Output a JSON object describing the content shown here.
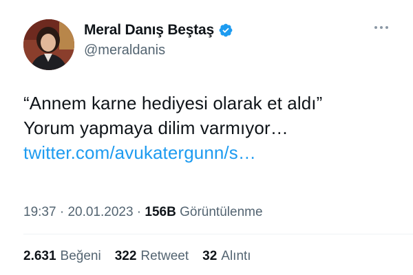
{
  "author": {
    "display_name": "Meral Danış Beştaş",
    "handle": "@meraldanis"
  },
  "tweet": {
    "line1": "“Annem karne hediyesi olarak et aldı”",
    "line2": "Yorum yapmaya dilim varmıyor…",
    "link": "twitter.com/avukatergunn/s…"
  },
  "meta": {
    "time": "19:37",
    "sep1": " · ",
    "date": "20.01.2023",
    "sep2": " · ",
    "views_count": "156B",
    "views_label": " Görüntülenme"
  },
  "stats": {
    "likes_count": "2.631",
    "likes_label": "Beğeni",
    "retweets_count": "322",
    "retweets_label": "Retweet",
    "quotes_count": "32",
    "quotes_label": "Alıntı"
  },
  "icons": {
    "verified": "verified-badge-icon",
    "more": "more-options-icon"
  },
  "colors": {
    "link": "#1d9bf0",
    "verified": "#1d9bf0",
    "secondary_text": "#536471",
    "primary_text": "#0f1419"
  }
}
